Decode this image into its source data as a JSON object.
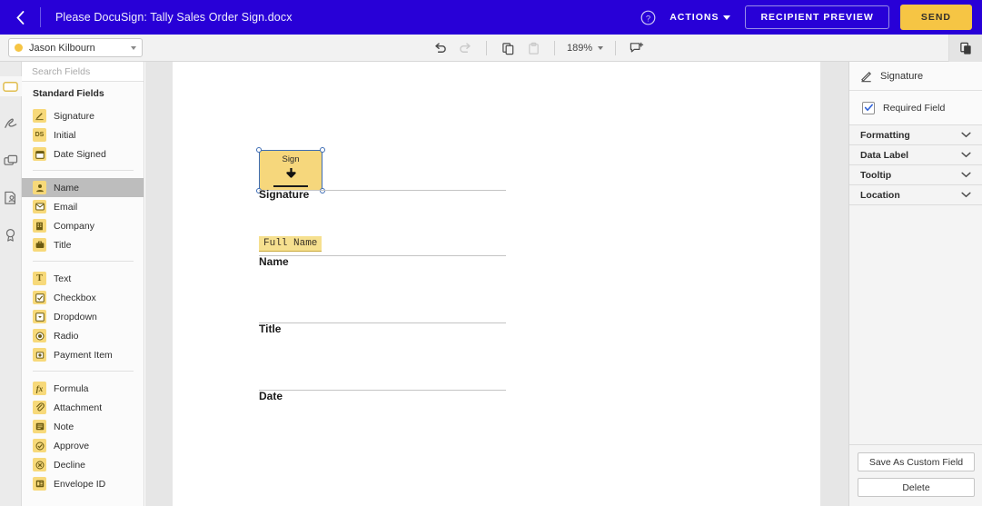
{
  "header": {
    "back_icon": "chevron-left-icon",
    "title": "Please DocuSign: Tally Sales Order Sign.docx",
    "help_icon": "help-circle-icon",
    "actions_label": "ACTIONS",
    "recipient_preview_label": "RECIPIENT PREVIEW",
    "send_label": "SEND",
    "background_color": "#2800d7",
    "send_color": "#f6c544"
  },
  "toolbar": {
    "recipient": {
      "name": "Jason Kilbourn",
      "dot_color": "#f6c544"
    },
    "undo_icon": "undo-icon",
    "redo_icon": "redo-icon",
    "copy_icon": "copy-icon",
    "paste_icon": "paste-icon",
    "zoom_level": "189%",
    "comment_icon": "add-comment-icon",
    "pages_icon": "pages-panel-icon"
  },
  "rail": {
    "items": [
      {
        "icon": "field-box-icon",
        "active": true
      },
      {
        "icon": "signature-pen-icon",
        "active": false
      },
      {
        "icon": "duplicate-pages-icon",
        "active": false
      },
      {
        "icon": "document-recipient-icon",
        "active": false
      },
      {
        "icon": "seal-stamp-icon",
        "active": false
      }
    ]
  },
  "fields_panel": {
    "search": {
      "placeholder": "Search Fields",
      "value": "",
      "icon": "search-icon",
      "clear_icon": "close-icon"
    },
    "section_title": "Standard Fields",
    "groups": [
      {
        "items": [
          {
            "label": "Signature",
            "icon": "signature-icon",
            "glyph": "",
            "selected": false
          },
          {
            "label": "Initial",
            "icon": "initial-icon",
            "glyph": "DS",
            "selected": false
          },
          {
            "label": "Date Signed",
            "icon": "calendar-icon",
            "glyph": "",
            "selected": false
          }
        ]
      },
      {
        "items": [
          {
            "label": "Name",
            "icon": "person-icon",
            "glyph": "",
            "selected": true
          },
          {
            "label": "Email",
            "icon": "envelope-icon",
            "glyph": "",
            "selected": false
          },
          {
            "label": "Company",
            "icon": "building-icon",
            "glyph": "",
            "selected": false
          },
          {
            "label": "Title",
            "icon": "briefcase-icon",
            "glyph": "",
            "selected": false
          }
        ]
      },
      {
        "items": [
          {
            "label": "Text",
            "icon": "text-icon",
            "glyph": "T",
            "selected": false
          },
          {
            "label": "Checkbox",
            "icon": "checkbox-icon",
            "glyph": "",
            "selected": false
          },
          {
            "label": "Dropdown",
            "icon": "dropdown-icon",
            "glyph": "",
            "selected": false
          },
          {
            "label": "Radio",
            "icon": "radio-icon",
            "glyph": "",
            "selected": false
          },
          {
            "label": "Payment Item",
            "icon": "payment-icon",
            "glyph": "",
            "selected": false
          }
        ]
      },
      {
        "items": [
          {
            "label": "Formula",
            "icon": "formula-icon",
            "glyph": "fx",
            "selected": false
          },
          {
            "label": "Attachment",
            "icon": "paperclip-icon",
            "glyph": "",
            "selected": false
          },
          {
            "label": "Note",
            "icon": "note-icon",
            "glyph": "",
            "selected": false
          },
          {
            "label": "Approve",
            "icon": "approve-check-icon",
            "glyph": "",
            "selected": false
          },
          {
            "label": "Decline",
            "icon": "decline-x-icon",
            "glyph": "",
            "selected": false
          },
          {
            "label": "Envelope ID",
            "icon": "envelope-id-icon",
            "glyph": "",
            "selected": false
          }
        ]
      }
    ]
  },
  "document": {
    "signature_field": {
      "text": "Sign",
      "arrow": "⬇"
    },
    "name_field": {
      "text": "Full Name"
    },
    "labels": [
      {
        "text": "Signature"
      },
      {
        "text": "Name"
      },
      {
        "text": "Title"
      },
      {
        "text": "Date"
      }
    ]
  },
  "properties": {
    "title": "Signature",
    "title_icon": "signature-pen-icon",
    "required_label": "Required Field",
    "required_checked": true,
    "sections": [
      {
        "label": "Formatting"
      },
      {
        "label": "Data Label"
      },
      {
        "label": "Tooltip"
      },
      {
        "label": "Location"
      }
    ],
    "save_custom_label": "Save As Custom Field",
    "delete_label": "Delete"
  }
}
